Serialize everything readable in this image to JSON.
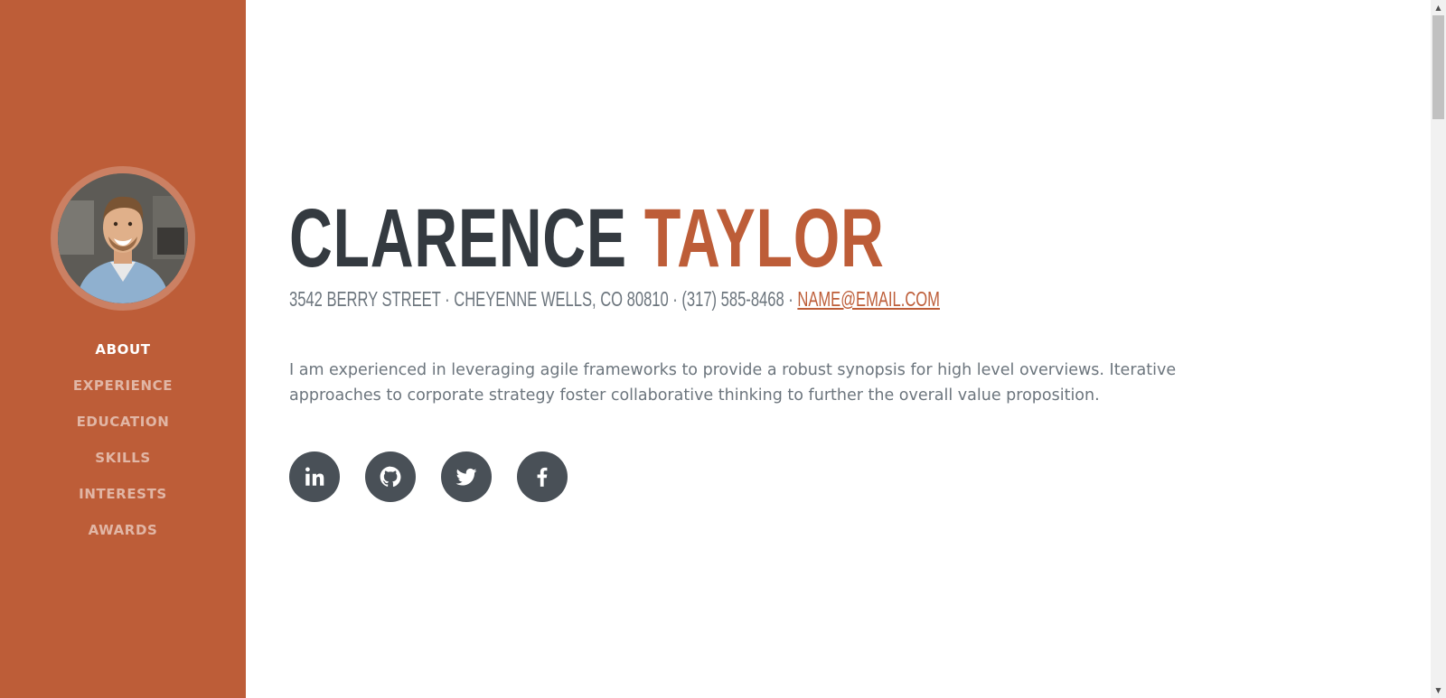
{
  "sidebar": {
    "avatar_alt": "profile photo",
    "nav": [
      {
        "label": "About",
        "active": true
      },
      {
        "label": "Experience",
        "active": false
      },
      {
        "label": "Education",
        "active": false
      },
      {
        "label": "Skills",
        "active": false
      },
      {
        "label": "Interests",
        "active": false
      },
      {
        "label": "Awards",
        "active": false
      }
    ]
  },
  "about": {
    "first_name": "Clarence",
    "last_name": "Taylor",
    "address": "3542 Berry Street · Cheyenne Wells, CO 80810 · (317) 585-8468 ·",
    "email": "name@email.com",
    "bio": "I am experienced in leveraging agile frameworks to provide a robust synopsis for high level overviews. Iterative approaches to corporate strategy foster collaborative thinking to further the overall value proposition."
  },
  "social": [
    {
      "icon": "linkedin-icon"
    },
    {
      "icon": "github-icon"
    },
    {
      "icon": "twitter-icon"
    },
    {
      "icon": "facebook-icon"
    }
  ],
  "colors": {
    "primary": "#bd5d38",
    "dark": "#343a40",
    "muted": "#6c757d",
    "social_bg": "#495057"
  }
}
